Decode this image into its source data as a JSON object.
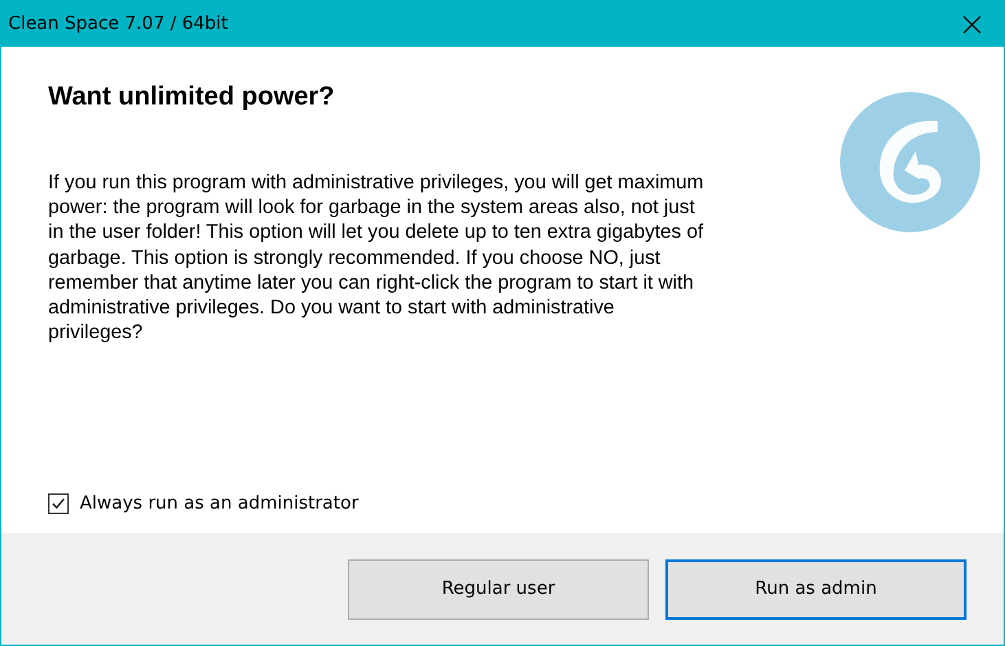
{
  "window": {
    "title": "Clean Space 7.07 / 64bit"
  },
  "heading": "Want unlimited power?",
  "message": "If you run this program with administrative privileges, you will get maximum power: the program will look for garbage in the system areas also, not just in the user folder! This option will let you delete up to ten extra gigabytes of garbage. This option is strongly recommended. If you choose NO, just remember that anytime later you can right-click the program to start it with administrative privileges. Do you want to start with administrative privileges?",
  "option": {
    "label": "Always run as an administrator",
    "checked": true
  },
  "buttons": [
    {
      "label": "Regular user",
      "focused": false
    },
    {
      "label": "Run as admin",
      "focused": true
    }
  ]
}
